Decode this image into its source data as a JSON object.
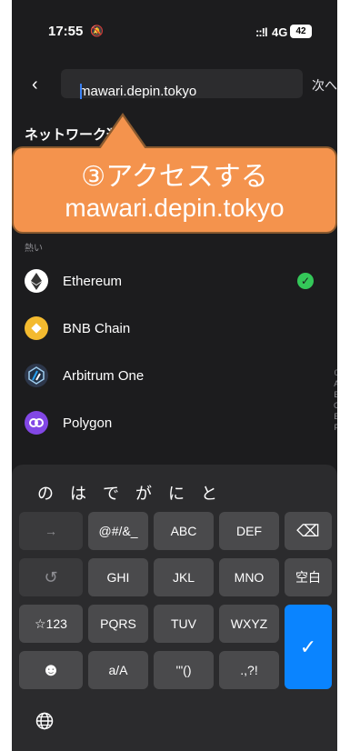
{
  "status": {
    "time": "17:55",
    "mute_icon": "bell-slash-icon",
    "network": "4G",
    "battery": "42",
    "signal": "::!l"
  },
  "topbar": {
    "back": "‹",
    "url": "mawari.depin.tokyo",
    "next": "次へ"
  },
  "section_title": "ネットワーク選択",
  "callout": {
    "line1": "③アクセスする",
    "line2": "mawari.depin.tokyo"
  },
  "hot_label": "熱い",
  "networks": [
    {
      "name": "Ethereum",
      "icon": "ethereum-icon",
      "color": "#ffffff",
      "selected": true
    },
    {
      "name": "BNB Chain",
      "icon": "bnb-icon",
      "color": "#f3ba2f",
      "selected": false
    },
    {
      "name": "Arbitrum One",
      "icon": "arbitrum-icon",
      "color": "#2d374b",
      "selected": false
    },
    {
      "name": "Polygon",
      "icon": "polygon-icon",
      "color": "#8247e5",
      "selected": false
    }
  ],
  "index_letters": [
    "0",
    "A",
    "B",
    "C",
    "E",
    "F"
  ],
  "keyboard": {
    "suggestions": [
      "の",
      "は",
      "で",
      "が",
      "に",
      "と"
    ],
    "keys": {
      "arrow": "→",
      "sym1": "@#/&_",
      "abc": "ABC",
      "def": "DEF",
      "backspace": "⌫",
      "undo": "↺",
      "ghi": "GHI",
      "jkl": "JKL",
      "mno": "MNO",
      "space": "空白",
      "num": "☆123",
      "pqrs": "PQRS",
      "tuv": "TUV",
      "wxyz": "WXYZ",
      "enter": "✓",
      "emoji": "☻",
      "case": "a/A",
      "punct1": "'\"()",
      "punct2": ".,?!",
      "globe": "🌐"
    }
  }
}
